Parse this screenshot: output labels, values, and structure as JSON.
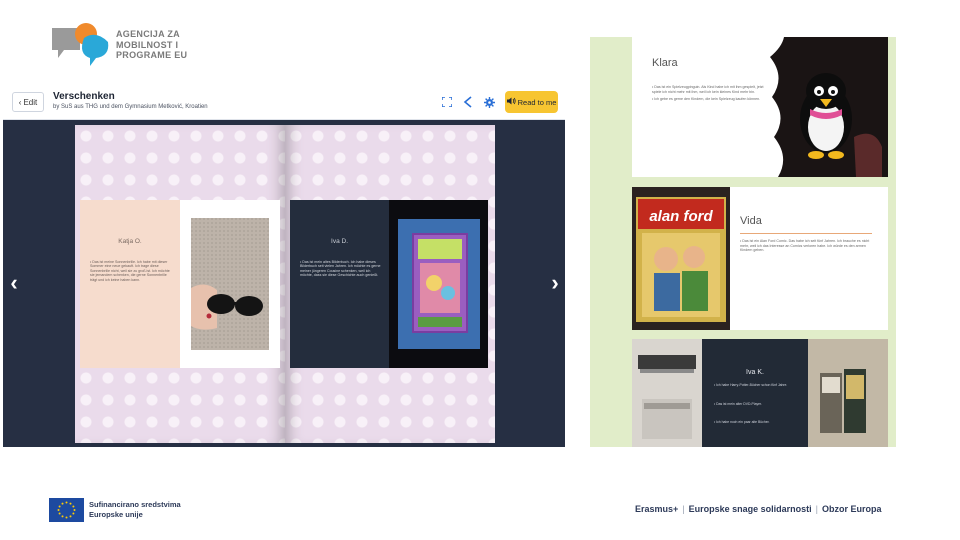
{
  "agency": {
    "line1": "AGENCIJA ZA",
    "line2": "MOBILNOST I",
    "line3": "PROGRAME EU"
  },
  "viewer": {
    "edit_label": "Edit",
    "title": "Verschenken",
    "subtitle": "by SuS aus THG und dem Gymnasium Metković, Kroatien",
    "read_label": "Read to me",
    "accent_color": "#f7c531",
    "icons": [
      "fullscreen-icon",
      "share-icon",
      "settings-icon",
      "speaker-icon"
    ],
    "left_page": {
      "name": "Katja O.",
      "text": "• Das ist meine Sonnenbrille. Ich habe mit dieser Sommer eine neue gekauft. Ich trage diese Sonnenbrille nicht, weil sie zu groß ist. Ich möchte sie jemandem schenken, die gerne Sonnenbrille trägt und ich keine haben kann."
    },
    "right_page": {
      "name": "Iva D.",
      "text": "• Das ist mein altes Bilderbuch. Ich habe dieses Bilderbuch seit vielen Jahren. Ich möchte es gerne meiner jüngeren Cousine schenken, weil ich möchte, dass sie diese Geschichte auch genießt."
    }
  },
  "slides": [
    {
      "name": "Klara",
      "bullets": [
        "• Das ist ein Spielzeugpinguin. Als Kind habe ich mit ihm gespielt, jetzt spiele ich nicht mehr mit ihm, weil ich kein kleines Kind mehr bin.",
        "• Ich gebe es gerne den Kindern, die kein Spielzeug kaufen können."
      ]
    },
    {
      "name": "Vida",
      "bullets": [
        "• Das ist ein Alan Ford Comic. Das habe ich seit fünf Jahren. Ich brauche es nicht mehr, weil ich das Interesse an Comics verloren habe. Ich würde es den armen Kindern geben."
      ],
      "comic_title": "alan ford"
    },
    {
      "name": "Iva K.",
      "bullets": [
        "• Ich habe Harry-Potter-Bücher schon fünf Jahre.",
        "• Das ist mein alter DVD-Player.",
        "• Ich habe noch ein paar alte Bücher."
      ]
    }
  ],
  "footer": {
    "eu_line1": "Sufinancirano sredstvima",
    "eu_line2": "Europske unije",
    "programmes": [
      "Erasmus+",
      "Europske snage solidarnosti",
      "Obzor Europa"
    ],
    "separator": "|"
  }
}
